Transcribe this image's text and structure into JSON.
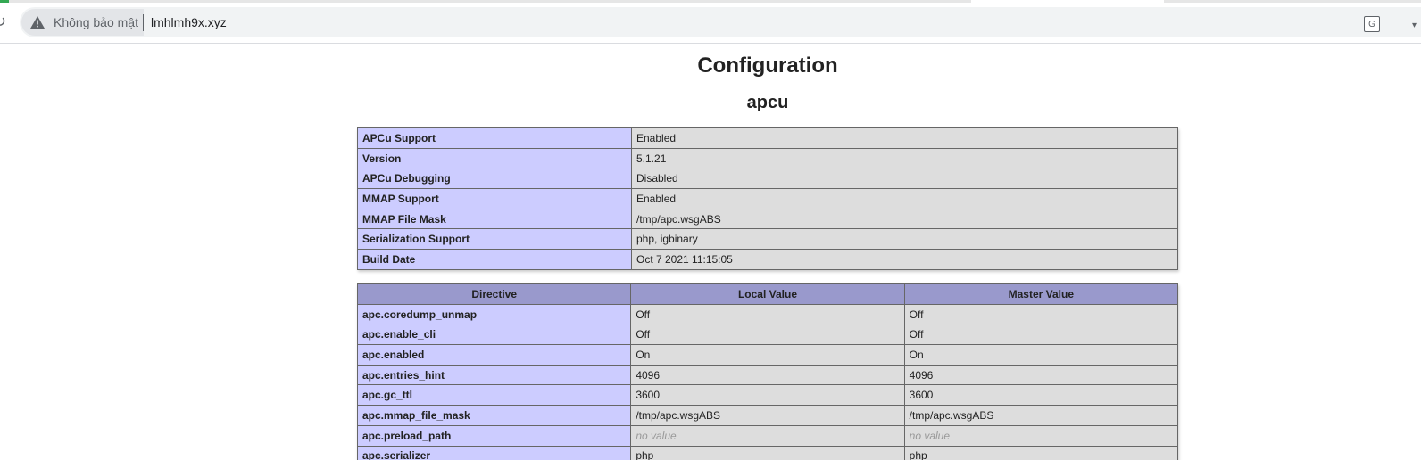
{
  "browser": {
    "security_label": "Không bảo mật",
    "url": "lmhlmh9x.xyz",
    "translate_glyph": "G",
    "reload_glyph": "↻",
    "menu_glyph": "▾"
  },
  "page": {
    "title": "Configuration",
    "module": "apcu",
    "info_rows": [
      {
        "name": "APCu Support",
        "value": "Enabled"
      },
      {
        "name": "Version",
        "value": "5.1.21"
      },
      {
        "name": "APCu Debugging",
        "value": "Disabled"
      },
      {
        "name": "MMAP Support",
        "value": "Enabled"
      },
      {
        "name": "MMAP File Mask",
        "value": "/tmp/apc.wsgABS"
      },
      {
        "name": "Serialization Support",
        "value": "php, igbinary"
      },
      {
        "name": "Build Date",
        "value": "Oct 7 2021 11:15:05"
      }
    ],
    "directive_headers": [
      "Directive",
      "Local Value",
      "Master Value"
    ],
    "directive_rows": [
      {
        "name": "apc.coredump_unmap",
        "local": "Off",
        "master": "Off"
      },
      {
        "name": "apc.enable_cli",
        "local": "Off",
        "master": "Off"
      },
      {
        "name": "apc.enabled",
        "local": "On",
        "master": "On"
      },
      {
        "name": "apc.entries_hint",
        "local": "4096",
        "master": "4096"
      },
      {
        "name": "apc.gc_ttl",
        "local": "3600",
        "master": "3600"
      },
      {
        "name": "apc.mmap_file_mask",
        "local": "/tmp/apc.wsgABS",
        "master": "/tmp/apc.wsgABS"
      },
      {
        "name": "apc.preload_path",
        "local": "no value",
        "master": "no value"
      },
      {
        "name": "apc.serializer",
        "local": "php",
        "master": "php"
      }
    ]
  },
  "colors": {
    "row_label_bg": "#ccccff",
    "row_value_bg": "#dddddd",
    "header_bg": "#9999cc",
    "no_value_text": "#999999"
  }
}
